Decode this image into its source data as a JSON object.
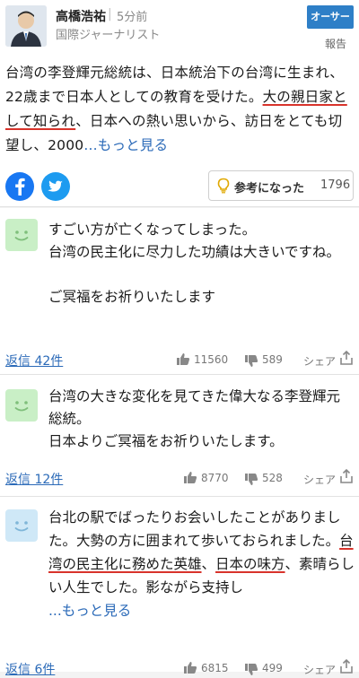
{
  "expert": {
    "author_name": "高橋浩祐",
    "separator": "|",
    "post_time": "5分前",
    "author_title": "国際ジャーナリスト",
    "badge_label": "オーサー",
    "report_label": "報告",
    "body_part1": "台湾の李登輝元総統は、日本統治下の台湾に生まれ、22歳まで日本人としての教育を受けた。",
    "body_underlined": "大の親日家として知られ",
    "body_part2": "、日本への熱い思いから、訪日をとても切望し、2000",
    "more_label": "...もっと見る",
    "helpful_label": "参考になった",
    "helpful_count": "1796"
  },
  "replies": [
    {
      "text_line1": "すごい方が亡くなってしまった。",
      "text_line2": "台湾の民主化に尽力した功績は大きいですね。",
      "text_line3": "ご冥福をお祈りいたします",
      "reply_count": "返信 42件",
      "likes": "11560",
      "dislikes": "589",
      "share_label": "シェア",
      "avatar_color": "#c9efc6"
    },
    {
      "text_line1": "台湾の大きな変化を見てきた偉大なる李登輝元総統。",
      "text_line2": "日本よりご冥福をお祈りいたします。",
      "reply_count": "返信 12件",
      "likes": "8770",
      "dislikes": "528",
      "share_label": "シェア",
      "avatar_color": "#c9efc6"
    },
    {
      "text_part1": "台北の駅でばったりお会いしたことがありました。大勢の方に囲まれて歩いておられました。",
      "underlined_a": "台湾の民主化に務めた英雄",
      "text_part2": "、",
      "underlined_b": "日本の味方",
      "text_part3": "、素晴らしい人生でした。影ながら支持し",
      "more_label": "...もっと見る",
      "reply_count": "返信 6件",
      "likes": "6815",
      "dislikes": "499",
      "share_label": "シェア",
      "avatar_color": "#cfe8f7"
    }
  ],
  "icons": {
    "facebook": "facebook-icon",
    "twitter": "twitter-icon",
    "bulb": "lightbulb-icon",
    "thumb_up": "thumbs-up-icon",
    "thumb_down": "thumbs-down-icon",
    "share": "share-icon"
  },
  "colors": {
    "link": "#2b6ab8",
    "badge": "#2e7fc7",
    "underline": "#d8332b",
    "facebook": "#1877f2",
    "twitter": "#1d9bf0"
  }
}
